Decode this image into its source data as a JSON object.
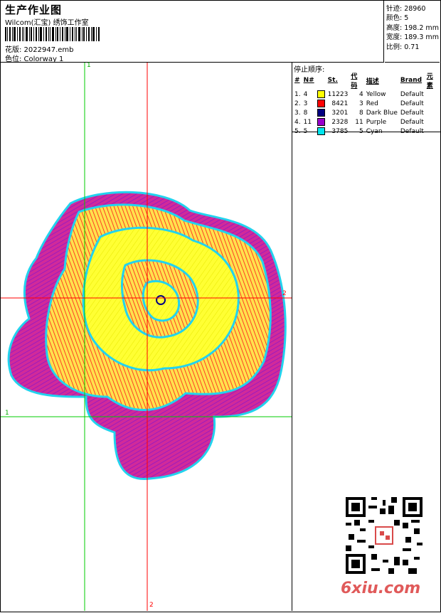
{
  "header": {
    "title": "生产作业图",
    "subtitle": "Wilcom(汇宝) 绣饰工作室",
    "design_label": "花版: 2022947.emb",
    "colorway_label": "色位: Colorway 1"
  },
  "specs": {
    "stitches": "针迹: 28960",
    "colors": "颜色: 5",
    "height": "高度: 198.2 mm",
    "width": "宽度: 189.3 mm",
    "scale": "比例: 0.71"
  },
  "stop_sequence": {
    "title": "停止顺序:",
    "headers": [
      "#",
      "N#",
      "St.",
      "代码",
      "描述",
      "Brand",
      "元素"
    ],
    "rows": [
      {
        "idx": "1.",
        "n": "4",
        "color": "#ffff00",
        "st": "11223",
        "code": "4",
        "desc": "Yellow",
        "brand": "Default"
      },
      {
        "idx": "2.",
        "n": "3",
        "color": "#ff0000",
        "st": "8421",
        "code": "3",
        "desc": "Red",
        "brand": "Default"
      },
      {
        "idx": "3.",
        "n": "8",
        "color": "#000080",
        "st": "3201",
        "code": "8",
        "desc": "Dark Blue",
        "brand": "Default"
      },
      {
        "idx": "4.",
        "n": "11",
        "color": "#9900cc",
        "st": "2328",
        "code": "11",
        "desc": "Purple",
        "brand": "Default"
      },
      {
        "idx": "5.",
        "n": "5",
        "color": "#00e5ee",
        "st": "3785",
        "code": "5",
        "desc": "Cyan",
        "brand": "Default"
      }
    ]
  },
  "axes": {
    "v1": "1",
    "h2": "2",
    "h1": "1",
    "v2": "2"
  },
  "watermark": "6xiu.com",
  "colors": {
    "green": "#00cc00",
    "red": "#ff0000"
  }
}
